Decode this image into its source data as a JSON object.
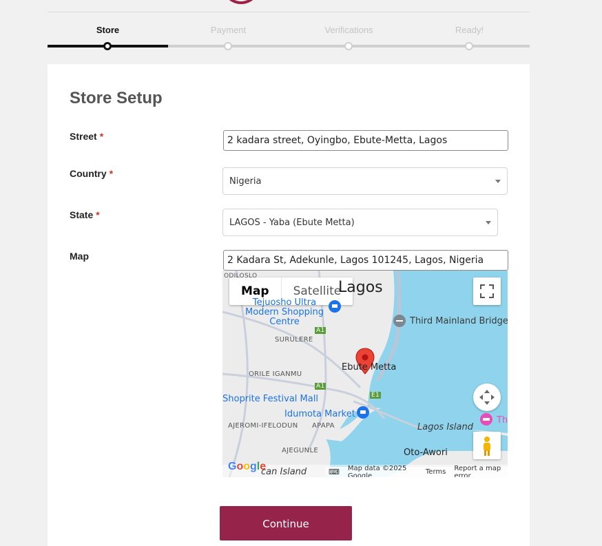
{
  "stepper": {
    "steps": [
      {
        "label": "Store"
      },
      {
        "label": "Payment"
      },
      {
        "label": "Verifications"
      },
      {
        "label": "Ready!"
      }
    ],
    "progress_fraction": 0.25
  },
  "form": {
    "title": "Store Setup",
    "required_mark": "*",
    "street": {
      "label": "Street",
      "value": "2 kadara street, Oyingbo, Ebute-Metta, Lagos"
    },
    "country": {
      "label": "Country",
      "value": "Nigeria"
    },
    "state": {
      "label": "State",
      "value": "LAGOS - Yaba (Ebute Metta)"
    },
    "map": {
      "label": "Map",
      "search_value": "2 Kadara St, Adekunle, Lagos 101245, Lagos, Nigeria"
    }
  },
  "map_widget": {
    "type_buttons": {
      "map": "Map",
      "satellite": "Satellite"
    },
    "labels": {
      "city": "Lagos",
      "shopping": "Tejuosho Ultra Modern Shopping Centre",
      "bridge": "Third Mainland Bridge",
      "surulere": "SURULERE",
      "ebute_metta": "Ebute Metta",
      "orile": "ORILE IGANMU",
      "shoprite": "Shoprite Festival Mall",
      "idumota": "Idumota Market",
      "ajeromi": "AJEROMI-IFELODUN",
      "apapa": "APAPA",
      "lagos_island": "Lagos Island",
      "ajegunle": "AJEGUNLE",
      "oto_awori": "Oto-Awori",
      "island_bottom": "can Island",
      "th": "Th",
      "road_a1_top": "A1",
      "road_a1_mid": "A1",
      "road_e1": "E1",
      "top_left": "ODILOSLO"
    },
    "footer": {
      "logo": "Google",
      "map_data": "Map data ©2025 Google",
      "terms": "Terms",
      "report": "Report a map error"
    },
    "colors": {
      "water": "#8fd4ec",
      "land": "#ececec",
      "pin": "#ea4335"
    }
  },
  "actions": {
    "continue_label": "Continue"
  },
  "colors": {
    "accent": "#96244a",
    "active_step": "#111111"
  }
}
